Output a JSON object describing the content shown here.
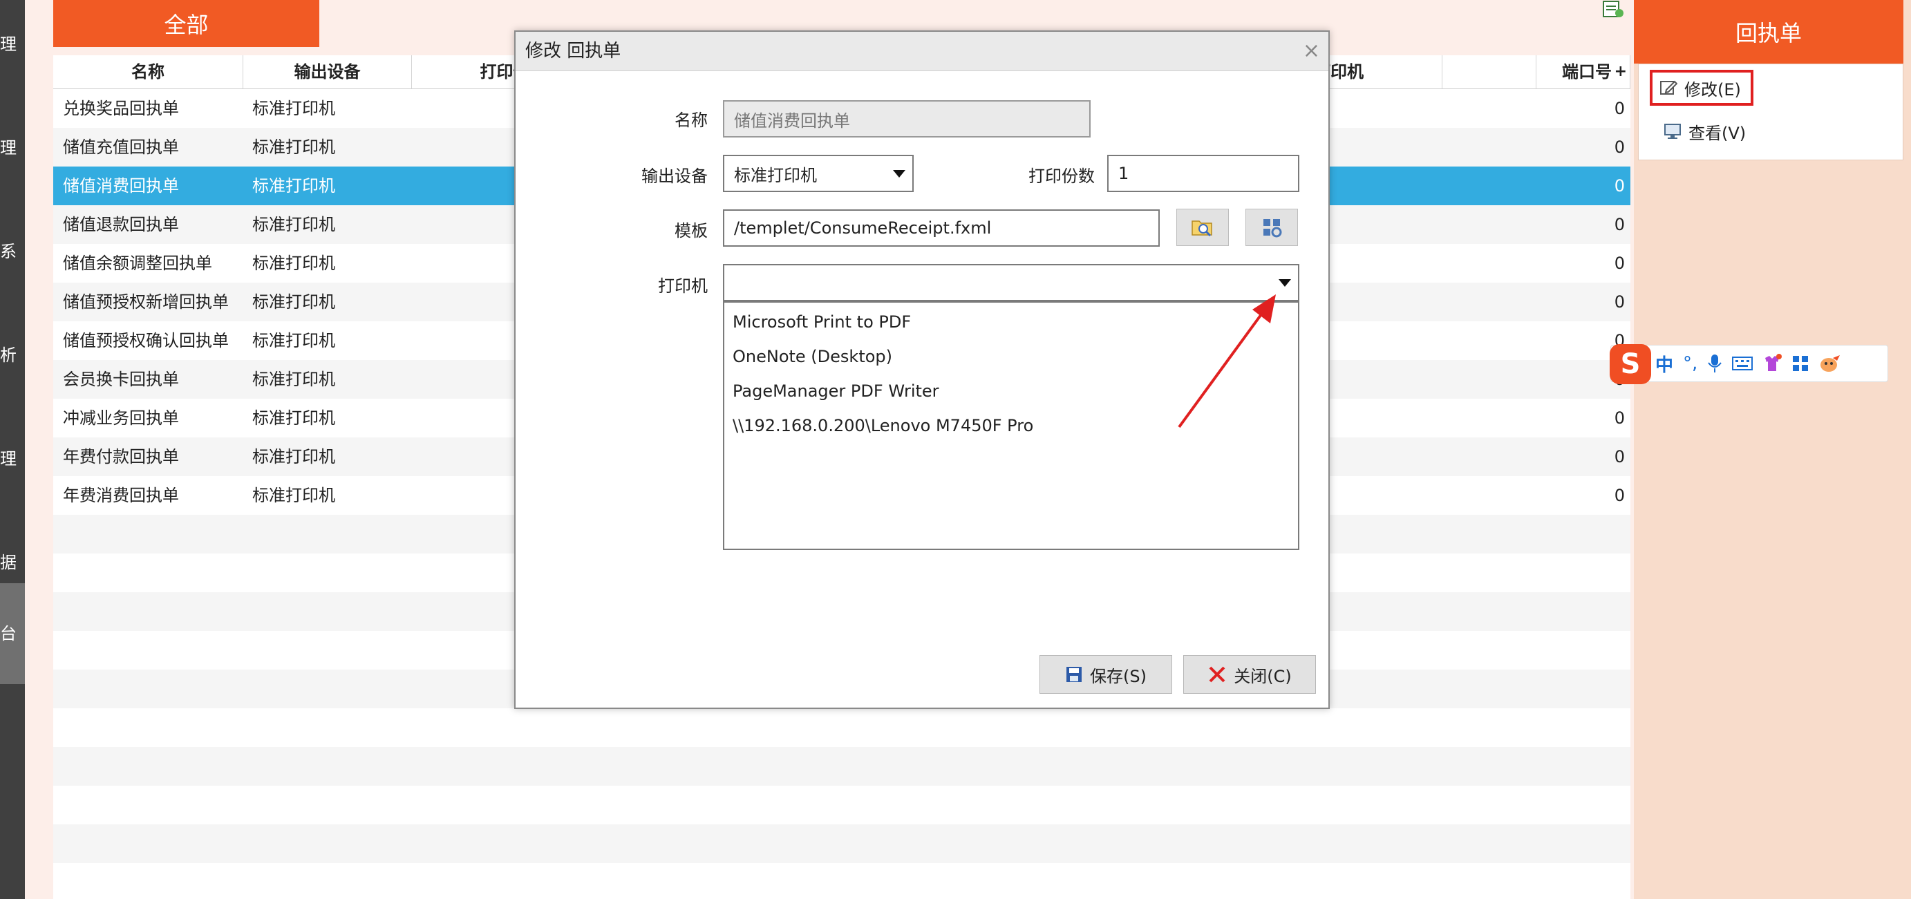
{
  "left_nav": {
    "items": [
      {
        "label": "理",
        "selected": false
      },
      {
        "label": "理",
        "selected": false
      },
      {
        "label": "系",
        "selected": false
      },
      {
        "label": "析",
        "selected": false
      },
      {
        "label": "理",
        "selected": false
      },
      {
        "label": "据",
        "selected": false
      },
      {
        "label": "台",
        "selected": true
      }
    ]
  },
  "top_tab": {
    "label": "全部"
  },
  "grid": {
    "columns": [
      "名称",
      "输出设备",
      "打印份",
      "打印机",
      "端口号"
    ],
    "rows": [
      {
        "name": "兑换奖品回执单",
        "device": "标准打印机",
        "port": "0"
      },
      {
        "name": "储值充值回执单",
        "device": "标准打印机",
        "port": "0"
      },
      {
        "name": "储值消费回执单",
        "device": "标准打印机",
        "port": "0",
        "selected": true
      },
      {
        "name": "储值退款回执单",
        "device": "标准打印机",
        "port": "0"
      },
      {
        "name": "储值余额调整回执单",
        "device": "标准打印机",
        "port": "0"
      },
      {
        "name": "储值预授权新增回执单",
        "device": "标准打印机",
        "port": "0"
      },
      {
        "name": "储值预授权确认回执单",
        "device": "标准打印机",
        "port": "0"
      },
      {
        "name": "会员换卡回执单",
        "device": "标准打印机",
        "port": "0"
      },
      {
        "name": "冲减业务回执单",
        "device": "标准打印机",
        "port": "0"
      },
      {
        "name": "年费付款回执单",
        "device": "标准打印机",
        "port": "0"
      },
      {
        "name": "年费消费回执单",
        "device": "标准打印机",
        "port": "0"
      }
    ],
    "empty_rows": 9
  },
  "right_panel": {
    "title": "回执单",
    "edit_label": "修改(E)",
    "view_label": "查看(V)"
  },
  "ime": {
    "logo": "S",
    "mode_label": "中",
    "punct": "°,"
  },
  "dialog": {
    "title": "修改 回执单",
    "name_label": "名称",
    "name_value": "储值消费回执单",
    "device_label": "输出设备",
    "device_value": "标准打印机",
    "copies_label": "打印份数",
    "copies_value": "1",
    "template_label": "模板",
    "template_value": "/templet/ConsumeReceipt.fxml",
    "printer_label": "打印机",
    "printer_value": "",
    "printer_options": [
      "Microsoft Print to PDF",
      "OneNote (Desktop)",
      "PageManager PDF Writer",
      "\\\\192.168.0.200\\Lenovo M7450F Pro"
    ],
    "save_label": "保存(S)",
    "close_label": "关闭(C)",
    "close_x": "×"
  },
  "colors": {
    "accent": "#f15a24",
    "selected_row": "#33ace0",
    "annotation": "#e02020"
  }
}
